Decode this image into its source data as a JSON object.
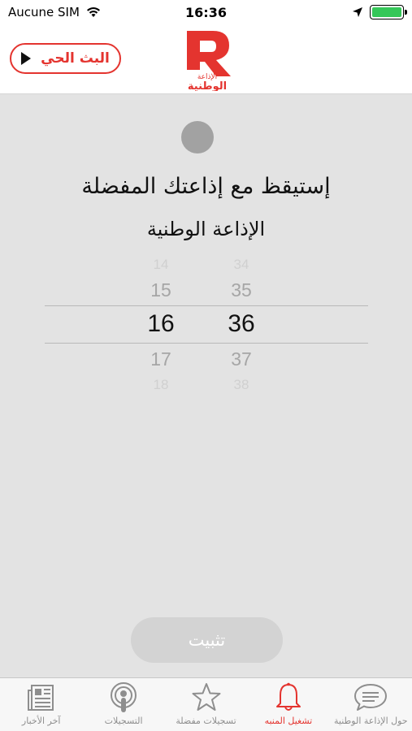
{
  "status_bar": {
    "carrier": "Aucune SIM",
    "time": "16:36",
    "battery_color": "#35c759"
  },
  "header": {
    "live_button_label": "البث الحي",
    "logo_text": "الإذاعة الوطنية",
    "accent_color": "#e4342f"
  },
  "alarm": {
    "headline": "إستيقظ مع إذاعتك المفضلة",
    "station": "الإذاعة الوطنية",
    "picker": {
      "hours": [
        "14",
        "15",
        "16",
        "17",
        "18"
      ],
      "minutes": [
        "34",
        "35",
        "36",
        "37",
        "38"
      ],
      "selected_hour": "16",
      "selected_minute": "36"
    },
    "pin_button_label": "تثبيت"
  },
  "tabs": [
    {
      "label": "آخر الأخبار",
      "icon": "newspaper-icon"
    },
    {
      "label": "التسجيلات",
      "icon": "podcast-icon"
    },
    {
      "label": "تسجيلات مفضلة",
      "icon": "star-icon"
    },
    {
      "label": "تشغيل المنبه",
      "icon": "bell-icon",
      "active": true
    },
    {
      "label": "حول الإذاعة الوطنية",
      "icon": "chat-icon"
    }
  ]
}
